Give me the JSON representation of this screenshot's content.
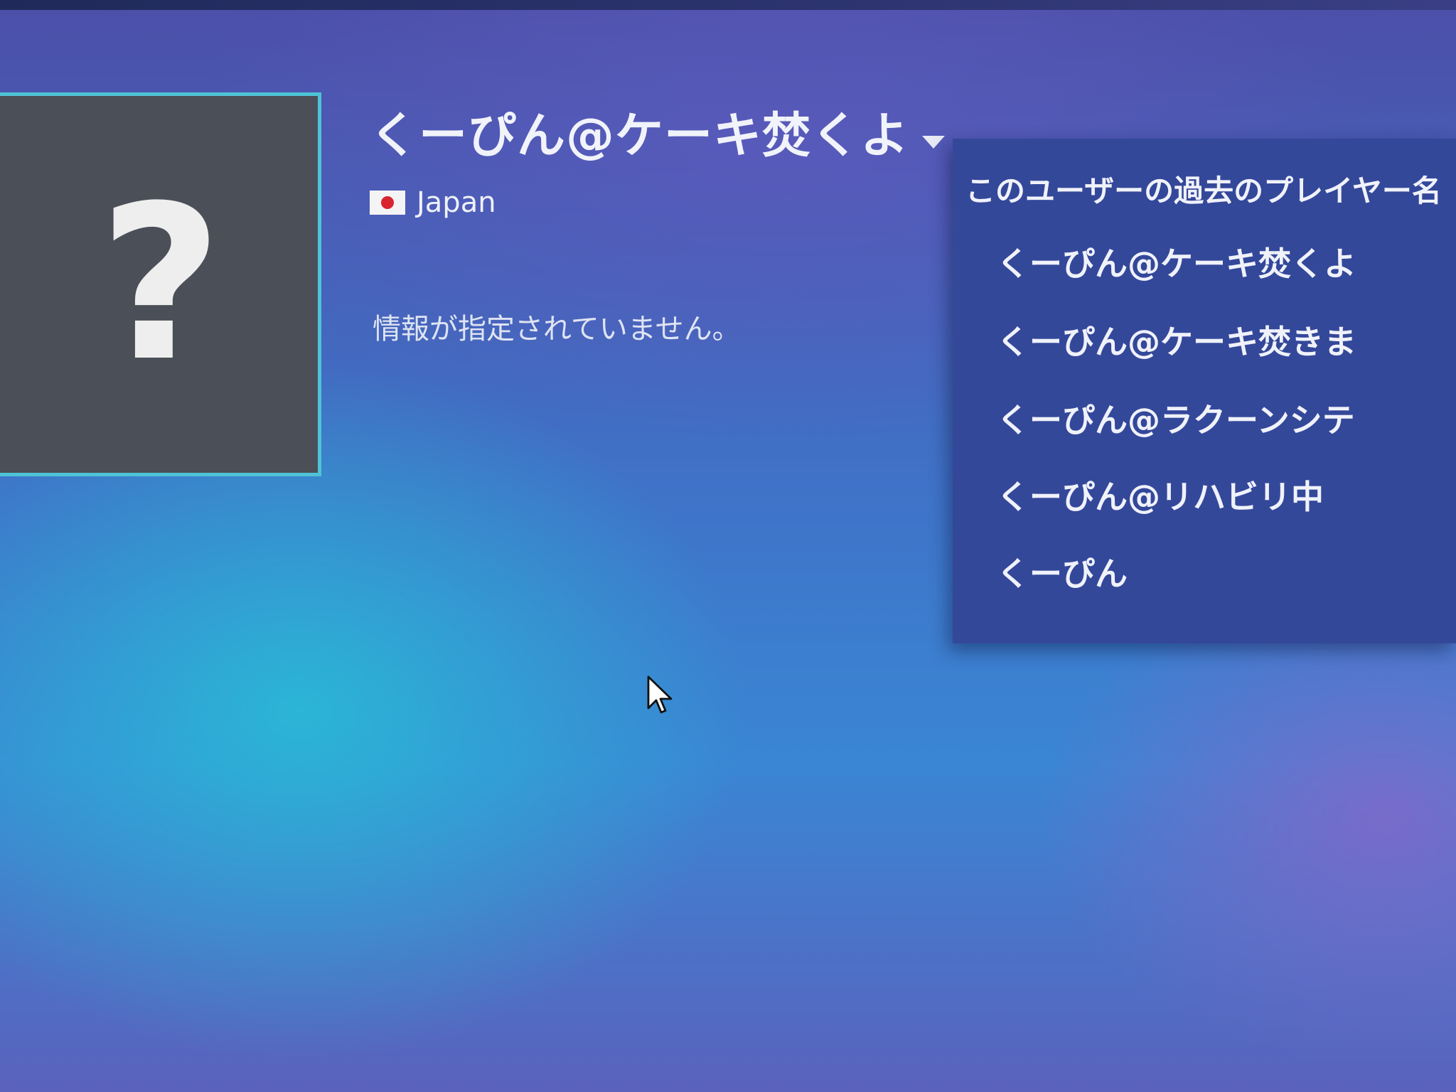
{
  "profile": {
    "name": "くーぴん@ケーキ焚くよ",
    "avatar_icon": "question-mark-icon",
    "avatar_glyph": "?",
    "country": "Japan",
    "flag_icon": "japan-flag-icon",
    "summary": "情報が指定されていません。"
  },
  "name_history": {
    "title": "このユーザーの過去のプレイヤー名",
    "items": [
      "くーぴん@ケーキ焚くよ",
      "くーぴん@ケーキ焚きま",
      "くーぴん@ラクーンシテ",
      "くーぴん@リハビリ中",
      "くーぴん"
    ]
  },
  "colors": {
    "avatar_border": "#4fc3d6",
    "dropdown_bg": "#34489a",
    "flag_red": "#d9232e"
  }
}
